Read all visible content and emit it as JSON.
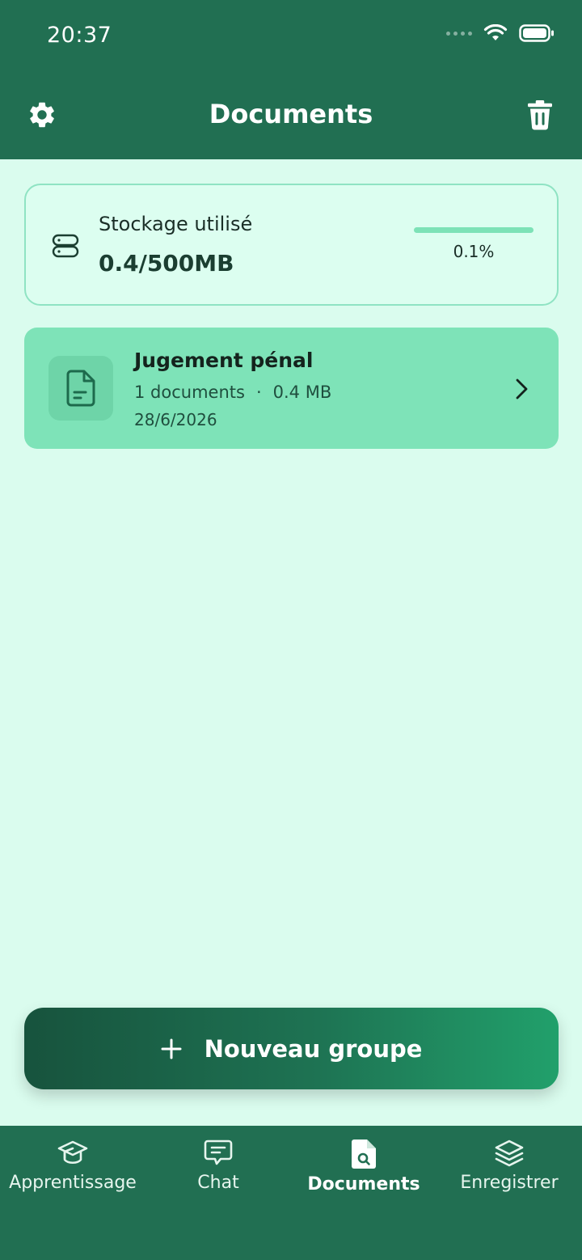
{
  "status_bar": {
    "time": "20:37"
  },
  "header": {
    "title": "Documents",
    "settings_icon": "gear-icon",
    "delete_icon": "trash-icon"
  },
  "storage": {
    "label": "Stockage utilisé",
    "value": "0.4/500MB",
    "percent_text": "0.1%",
    "progress_fraction": 0.001
  },
  "groups": [
    {
      "title": "Jugement pénal",
      "count": "1 documents",
      "separator": "·",
      "size": "0.4 MB",
      "date": "28/6/2026"
    }
  ],
  "new_group_button": {
    "label": "Nouveau groupe"
  },
  "tabbar": {
    "tabs": [
      {
        "label": "Apprentissage",
        "icon": "graduation-cap-icon",
        "active": false
      },
      {
        "label": "Chat",
        "icon": "chat-bubble-icon",
        "active": false
      },
      {
        "label": "Documents",
        "icon": "document-search-icon",
        "active": true
      },
      {
        "label": "Enregistrer",
        "icon": "layers-icon",
        "active": false
      }
    ]
  },
  "colors": {
    "header": "#216f52",
    "background": "#dafcee",
    "card": "#7ee3b8",
    "accent": "#7de2b7"
  }
}
